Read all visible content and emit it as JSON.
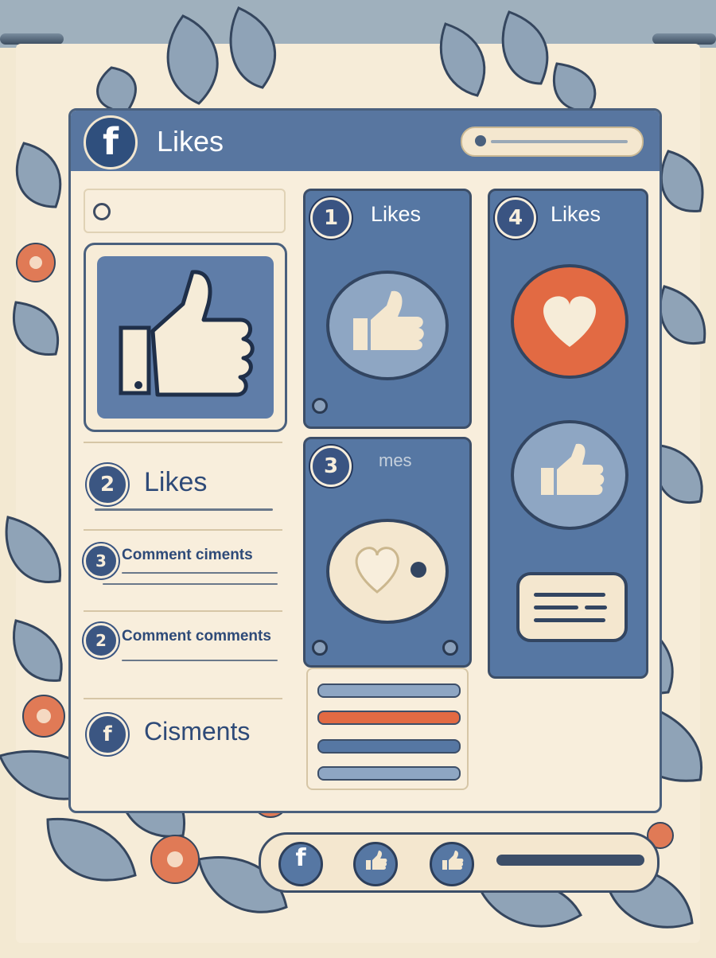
{
  "window": {
    "title": "Likes",
    "logo": "f"
  },
  "left": {
    "row_likes": {
      "number": "2",
      "label": "Likes"
    },
    "row_comment_1": {
      "number": "3",
      "label": "Comment ciments"
    },
    "row_comment_2": {
      "number": "2",
      "label": "Comment comments"
    },
    "row_bottom": {
      "label": "Cisments",
      "icon": "facebook-icon"
    }
  },
  "panels": {
    "panel_1": {
      "number": "1",
      "label": "Likes",
      "icon": "thumbs-up-icon"
    },
    "panel_3": {
      "number": "3",
      "label": "mes",
      "icon": "heart-icon"
    },
    "panel_4": {
      "number": "4",
      "label": "Likes",
      "icons": [
        "heart-icon",
        "thumbs-up-icon",
        "message-icon"
      ]
    }
  },
  "bottom_bar": {
    "buttons": [
      "facebook-icon",
      "thumbs-up-icon",
      "thumbs-up-icon"
    ],
    "slider": "slider"
  },
  "colors": {
    "primary": "#5677a3",
    "dark": "#324561",
    "accent": "#e26a43",
    "paper": "#f6ecd8"
  }
}
